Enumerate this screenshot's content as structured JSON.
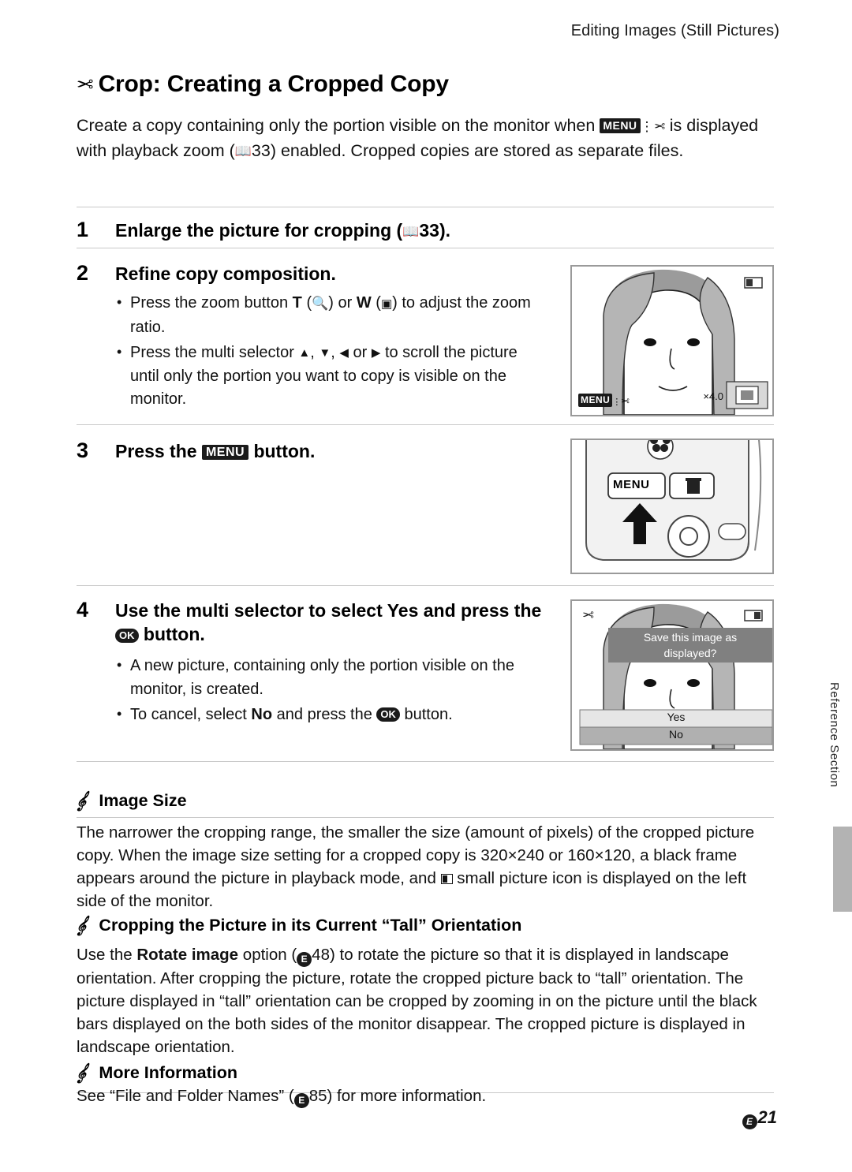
{
  "header": {
    "running_head": "Editing Images (Still Pictures)"
  },
  "title": {
    "icon": "scissors-icon",
    "text": "Crop: Creating a Cropped Copy"
  },
  "intro": {
    "line1_a": "Create a copy containing only the portion visible on the monitor when ",
    "menu_scissors_icon": "MENU",
    "line1_b": " is",
    "line2_a": "displayed with playback zoom (",
    "ref1": "33) enabled. Cropped copies are stored as",
    "line3": "separate files."
  },
  "steps": [
    {
      "num": "1",
      "text_a": "Enlarge the picture for cropping (",
      "ref": "33).",
      "bullets": []
    },
    {
      "num": "2",
      "text": "Refine copy composition.",
      "bullets": [
        "Press the zoom button T (Q) or W (H) to adjust the zoom ratio.",
        "Press the multi selector H, I, J or K to scroll the picture until only the portion you want to copy is visible on the monitor."
      ]
    },
    {
      "num": "3",
      "text_a": "Press the ",
      "icon": "MENU",
      "text_b": " button."
    },
    {
      "num": "4",
      "text_a": "Use the multi selector to select ",
      "yes": "Yes",
      "text_b": " and press the ",
      "ok_icon": "OK",
      "text_c": " button.",
      "bullets": [
        "A new picture, containing only the portion visible on the monitor, is created.",
        "To cancel, select No and press the OK button."
      ]
    }
  ],
  "figures": {
    "monitor": {
      "menu_badge": "MENU",
      "zoom_label": "×4.0"
    },
    "camera": {
      "menu_button_label": "MENU",
      "flower_icon": "macro-flower-icon",
      "trash_icon": "trash-icon"
    },
    "confirm": {
      "message_line1": "Save this image as",
      "message_line2": "displayed?",
      "option_yes": "Yes",
      "option_no": "No"
    }
  },
  "notes": [
    {
      "heading": "Image Size",
      "body": "The narrower the cropping range, the smaller the size (amount of pixels) of the cropped picture copy. When the image size setting for a cropped copy is 320×240 or 160×120, a black frame appears around the picture in playback mode, and a small picture icon is displayed on the left side of the monitor."
    },
    {
      "heading": "Cropping the Picture in its Current “Tall” Orientation",
      "body": "Use the Rotate image option (E48) to rotate the picture so that it is displayed in landscape orientation. After cropping the picture, rotate the cropped picture back to “tall” orientation. The picture displayed in “tall” orientation can be cropped by zooming in on the picture until the black bars displayed on the both sides of the monitor disappear. The cropped picture is displayed in landscape orientation.",
      "bold_term": "Rotate image",
      "ref": "48"
    },
    {
      "heading": "More Information",
      "body": "See “File and Folder Names” (E85) for more information.",
      "ref": "85"
    }
  ],
  "side_tab": {
    "label": "Reference Section"
  },
  "page_number": {
    "prefix": "E",
    "number": "21"
  }
}
